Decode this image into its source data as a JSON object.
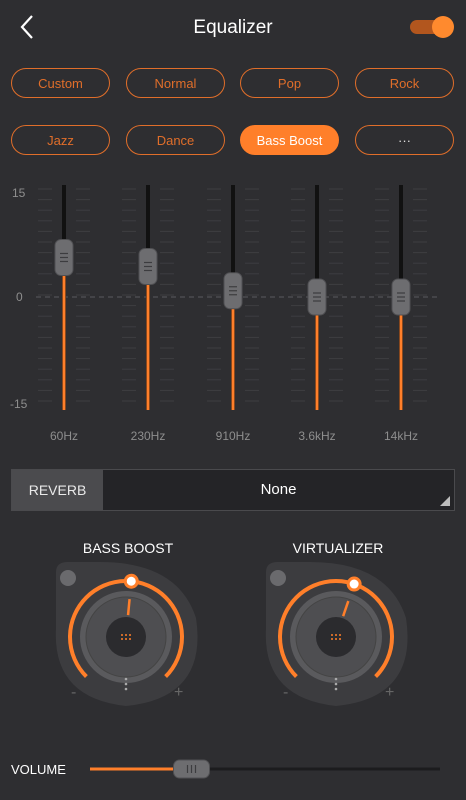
{
  "header": {
    "title": "Equalizer",
    "enabled": true
  },
  "presets": [
    {
      "label": "Custom",
      "active": false
    },
    {
      "label": "Normal",
      "active": false
    },
    {
      "label": "Pop",
      "active": false
    },
    {
      "label": "Rock",
      "active": false
    },
    {
      "label": "Jazz",
      "active": false
    },
    {
      "label": "Dance",
      "active": false
    },
    {
      "label": "Bass Boost",
      "active": true
    },
    {
      "label": "···",
      "active": false
    }
  ],
  "eq": {
    "y_labels": [
      "15",
      "0",
      "-15"
    ],
    "range": [
      -15,
      15
    ],
    "bands": [
      {
        "label": "60Hz",
        "value": 5.7
      },
      {
        "label": "230Hz",
        "value": 4.4
      },
      {
        "label": "910Hz",
        "value": 0.9
      },
      {
        "label": "3.6kHz",
        "value": 0
      },
      {
        "label": "14kHz",
        "value": 0
      }
    ]
  },
  "reverb": {
    "label": "REVERB",
    "value": "None"
  },
  "knobs": [
    {
      "title": "BASS BOOST",
      "minus": "-",
      "plus": "+",
      "level": 0.52
    },
    {
      "title": "VIRTUALIZER",
      "minus": "-",
      "plus": "+",
      "level": 0.57
    }
  ],
  "volume": {
    "label": "VOLUME",
    "level": 0.29
  },
  "colors": {
    "accent": "#ff7f2a",
    "background": "#2e2e31"
  }
}
